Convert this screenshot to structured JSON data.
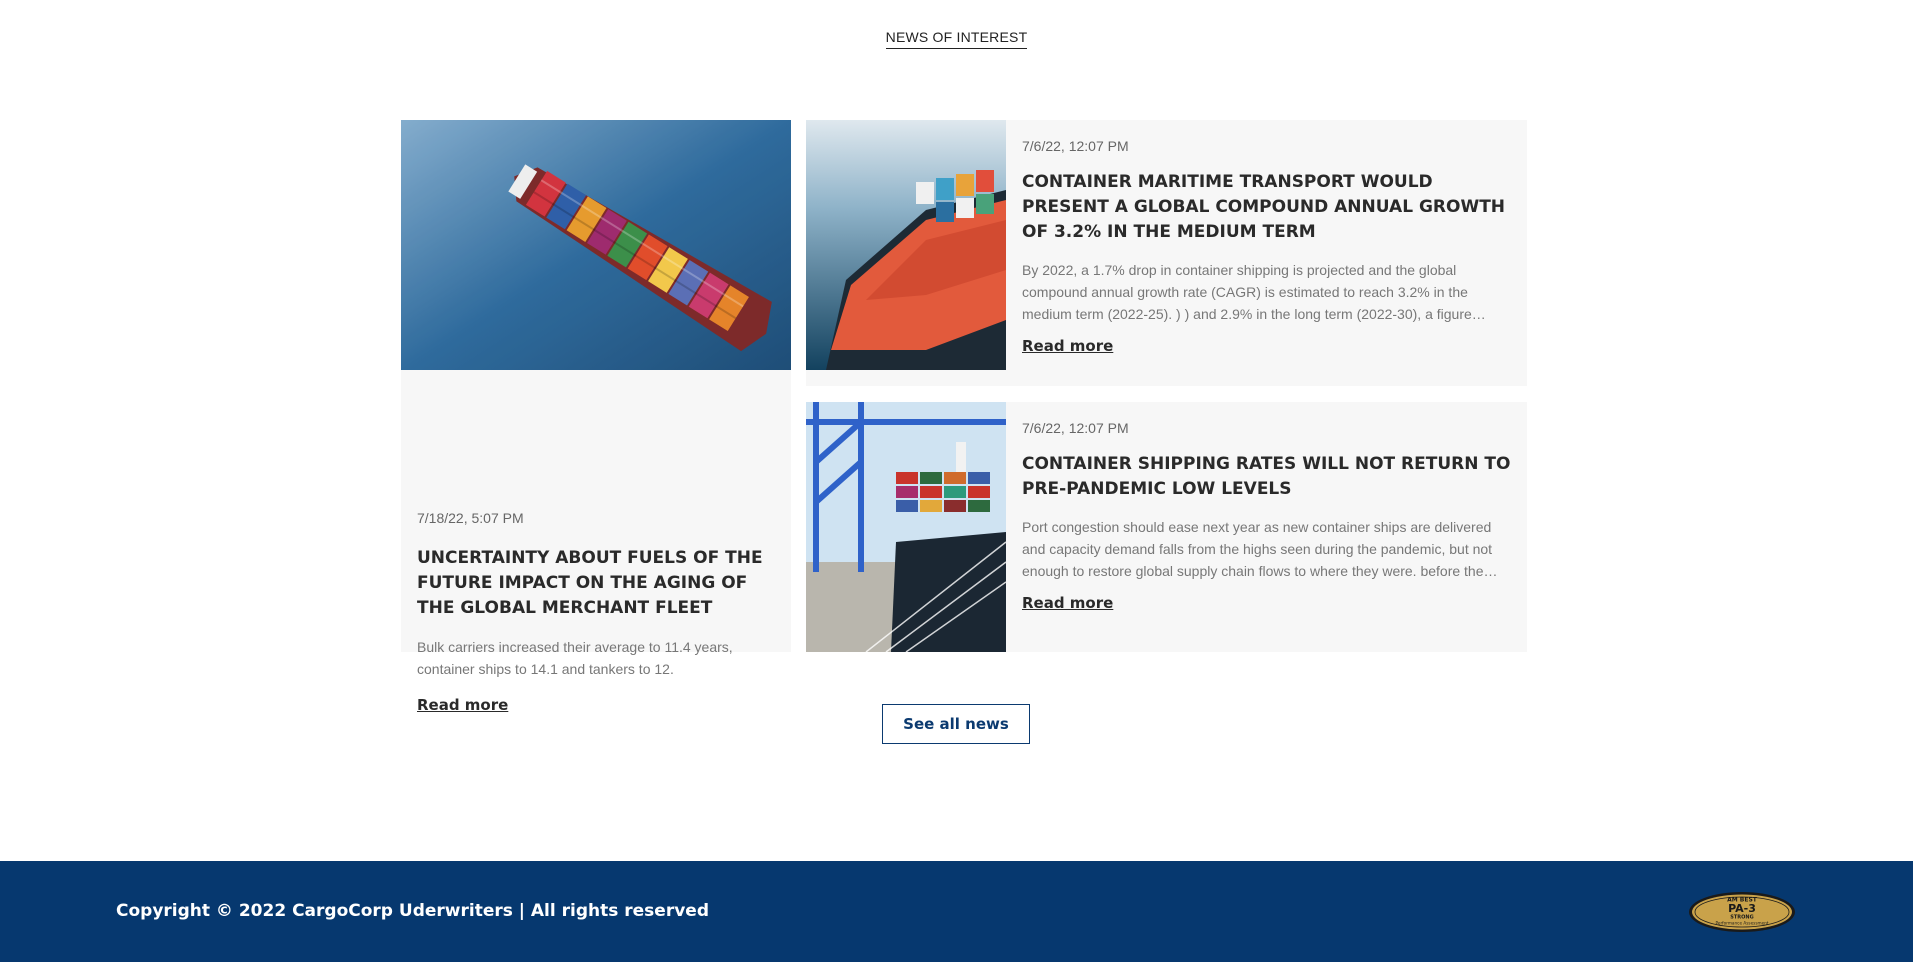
{
  "section": {
    "title": "NEWS OF INTEREST"
  },
  "featured": {
    "date": "7/18/22, 5:07 PM",
    "title": "UNCERTAINTY ABOUT FUELS OF THE FUTURE IMPACT ON THE AGING OF THE GLOBAL MERCHANT FLEET",
    "excerpt": "Bulk carriers increased their average to 11.4 years, container ships to 14.1 and tankers to 12.",
    "read_more": "Read more"
  },
  "articles": [
    {
      "date": "7/6/22, 12:07 PM",
      "title": "CONTAINER MARITIME TRANSPORT WOULD PRESENT A GLOBAL COMPOUND ANNUAL GROWTH OF 3.2% IN THE MEDIUM TERM",
      "excerpt": "By 2022, a 1.7% drop in container shipping is projected and the global compound annual growth rate (CAGR) is estimated to reach 3.2% in the medium term (2022-25). ) ) and 2.9% in the long term (2022-30), a figure that…",
      "read_more": "Read more"
    },
    {
      "date": "7/6/22, 12:07 PM",
      "title": "CONTAINER SHIPPING RATES WILL NOT RETURN TO PRE-PANDEMIC LOW LEVELS",
      "excerpt": "Port congestion should ease next year as new container ships are delivered and capacity demand falls from the highs seen during the pandemic, but not enough to restore global supply chain flows to where they were. before the…",
      "read_more": "Read more"
    }
  ],
  "see_all": "See all news",
  "footer": {
    "copyright": "Copyright © 2022 CargoCorp Uderwriters | All rights reserved",
    "badge": {
      "line1": "AM BEST",
      "line2": "PA-3",
      "line3": "STRONG",
      "line4": "Performance Assessment"
    }
  },
  "colors": {
    "brand_navy": "#06386f",
    "card_bg": "#f7f7f7",
    "badge_gold": "#c9a24a"
  }
}
